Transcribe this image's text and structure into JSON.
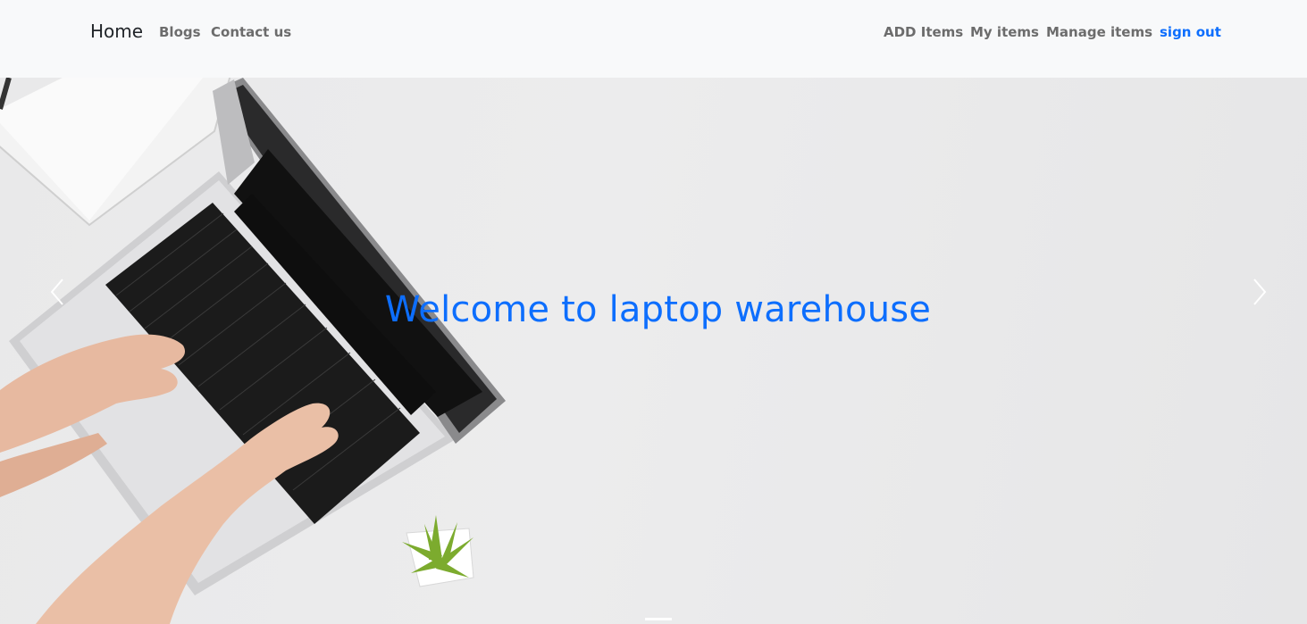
{
  "navbar": {
    "brand": "Home",
    "left_links": [
      "Blogs",
      "Contact us"
    ],
    "right_links": [
      "ADD Items",
      "My items",
      "Manage items"
    ],
    "signout": "sign out",
    "accent_color": "#0d6efd"
  },
  "hero": {
    "title": "Welcome to laptop warehouse",
    "prev_icon": "chevron-left-icon",
    "next_icon": "chevron-right-icon",
    "indicator_count": 1,
    "active_indicator": 1
  }
}
